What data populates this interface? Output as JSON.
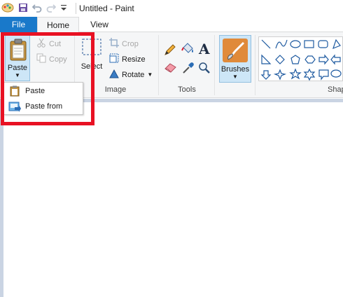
{
  "window": {
    "title": "Untitled - Paint"
  },
  "tabs": [
    {
      "label": "File"
    },
    {
      "label": "Home"
    },
    {
      "label": "View"
    }
  ],
  "clipboard": {
    "paste_label": "Paste",
    "cut_label": "Cut",
    "copy_label": "Copy"
  },
  "image": {
    "group_label": "Image",
    "select_label": "Select",
    "crop_label": "Crop",
    "resize_label": "Resize",
    "rotate_label": "Rotate"
  },
  "tools": {
    "group_label": "Tools"
  },
  "brushes": {
    "label": "Brushes"
  },
  "shapes": {
    "group_label": "Shap"
  },
  "paste_menu": {
    "items": [
      {
        "label": "Paste"
      },
      {
        "label": "Paste from"
      }
    ]
  },
  "colors": {
    "accent": "#1979ca",
    "pressed_bg": "#cde6f7",
    "workspace": "#cad4e3",
    "highlight": "#e81123"
  }
}
